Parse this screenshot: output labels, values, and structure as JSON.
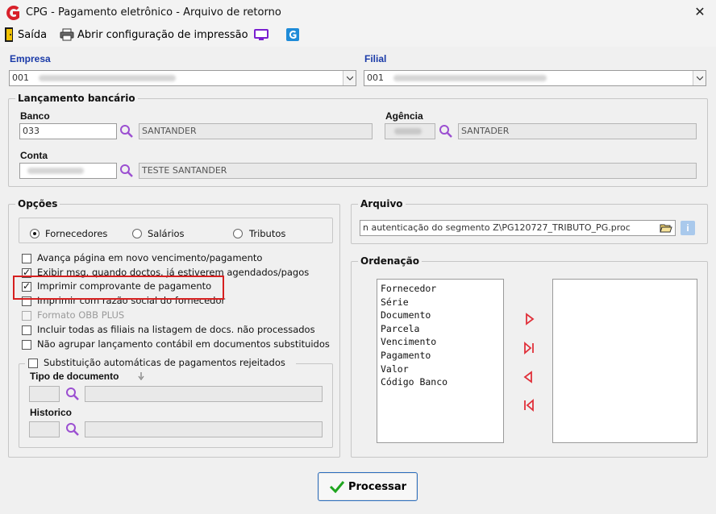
{
  "window": {
    "title": "CPG - Pagamento eletrônico - Arquivo de retorno",
    "close_glyph": "✕"
  },
  "toolbar": {
    "exit_label": "Saída",
    "print_config_label": "Abrir configuração de impressão"
  },
  "empresa": {
    "label": "Empresa",
    "code": "001"
  },
  "filial": {
    "label": "Filial",
    "code": "001"
  },
  "lancamento": {
    "title": "Lançamento bancário",
    "banco_label": "Banco",
    "banco_code": "033",
    "banco_name": "SANTANDER",
    "agencia_label": "Agência",
    "agencia_name": "SANTADER",
    "conta_label": "Conta",
    "conta_name": "TESTE SANTANDER"
  },
  "opcoes": {
    "title": "Opções",
    "radios": [
      {
        "label": "Fornecedores",
        "selected": true
      },
      {
        "label": "Salários",
        "selected": false
      },
      {
        "label": "Tributos",
        "selected": false
      }
    ],
    "checks": [
      {
        "label": "Avança página em novo vencimento/pagamento",
        "checked": false,
        "enabled": true
      },
      {
        "label": "Exibir msg. quando doctos. já estiverem agendados/pagos",
        "checked": true,
        "enabled": true
      },
      {
        "label": "Imprimir comprovante de pagamento",
        "checked": true,
        "enabled": true
      },
      {
        "label": "Imprimir com razão social do fornecedor",
        "checked": false,
        "enabled": true
      },
      {
        "label": "Formato OBB PLUS",
        "checked": false,
        "enabled": false
      },
      {
        "label": "Incluir todas as filiais na listagem de docs. não processados",
        "checked": false,
        "enabled": true
      },
      {
        "label": "Não agrupar lançamento contábil em documentos substituidos",
        "checked": false,
        "enabled": true
      }
    ],
    "substituicao_label": "Substituição automáticas de pagamentos rejeitados",
    "tipo_doc_label": "Tipo de documento",
    "historico_label": "Historico"
  },
  "arquivo": {
    "title": "Arquivo",
    "path": "n autenticação do segmento Z\\PG120727_TRIBUTO_PG.proc"
  },
  "ordenacao": {
    "title": "Ordenação",
    "available": [
      "Fornecedor",
      "Série",
      "Documento",
      "Parcela",
      "Vencimento",
      "Pagamento",
      "Valor",
      "Código Banco"
    ],
    "selected": []
  },
  "process_button": {
    "label": "Processar"
  },
  "colors": {
    "label_blue": "#1a3aa8",
    "highlight": "#d62020",
    "arrow_red": "#e0303a",
    "lupa": "#9b4fd1"
  },
  "icons": [
    "app-logo-icon",
    "exit-door-icon",
    "printer-icon",
    "monitor-icon",
    "g-icon",
    "lupa-icon",
    "folder-open-icon",
    "info-icon",
    "check-icon"
  ]
}
